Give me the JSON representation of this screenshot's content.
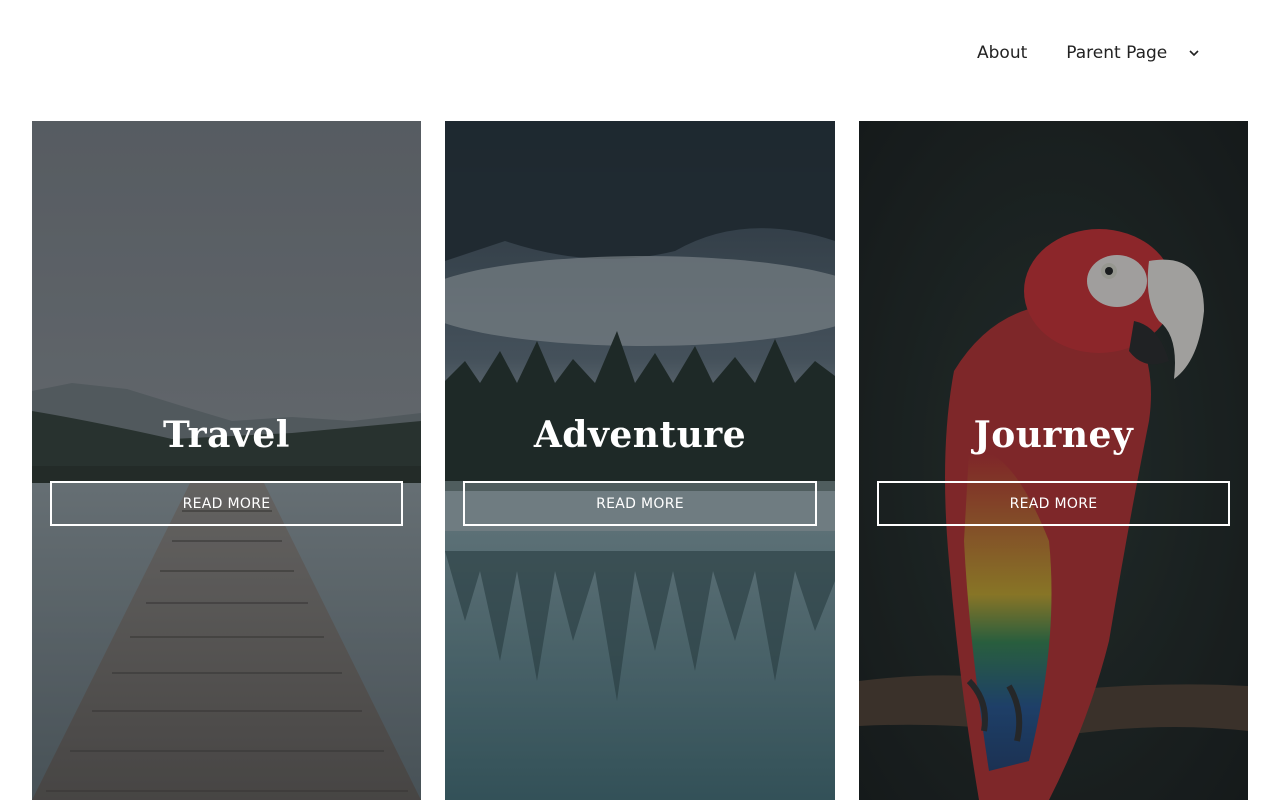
{
  "nav": {
    "items": [
      {
        "label": "About"
      },
      {
        "label": "Parent Page",
        "has_dropdown": true,
        "icon": "chevron-down-icon"
      }
    ]
  },
  "cards": [
    {
      "title": "Travel",
      "button_label": "READ MORE",
      "image": "wooden dock on a misty lake"
    },
    {
      "title": "Adventure",
      "button_label": "READ MORE",
      "image": "pine forest reflected in a foggy lake"
    },
    {
      "title": "Journey",
      "button_label": "READ MORE",
      "image": "scarlet macaw on a branch"
    }
  ],
  "colors": {
    "background": "#ffffff",
    "nav_text": "#222222",
    "card_text": "#ffffff"
  }
}
